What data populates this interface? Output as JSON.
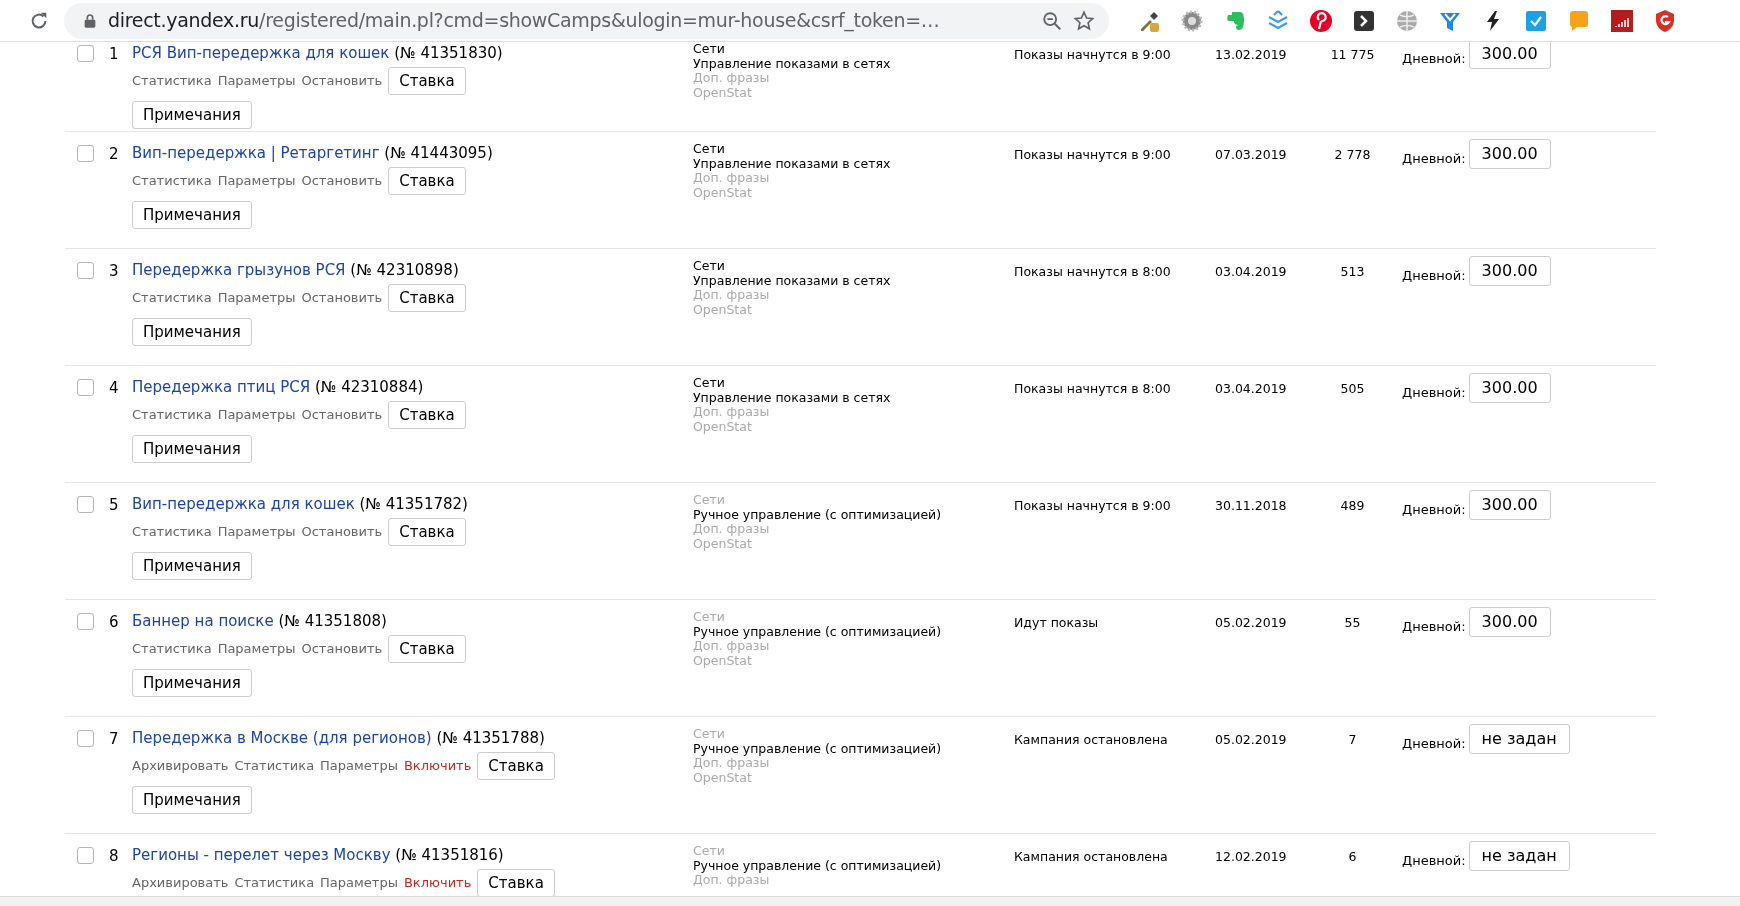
{
  "browser": {
    "url_host": "direct.yandex.ru",
    "url_path": "/registered/main.pl?cmd=showCamps&ulogin=mur-house&csrf_token=…"
  },
  "campaigns": [
    {
      "checked": false,
      "number": "1",
      "title": "РСЯ Вип-передержка для кошек",
      "campaign_id": "(№ 41351830)",
      "actions": [
        {
          "label": "Статистика",
          "kind": "normal"
        },
        {
          "label": "Параметры",
          "kind": "normal"
        },
        {
          "label": "Остановить",
          "kind": "normal"
        }
      ],
      "bid_button": "Ставка",
      "notes_button": "Примечания",
      "strategy": [
        {
          "text": "Сети",
          "muted": false
        },
        {
          "text": "Управление показами в сетях",
          "muted": false
        },
        {
          "text": "Доп. фразы",
          "muted": true
        },
        {
          "text": "OpenStat",
          "muted": true
        }
      ],
      "status": "Показы начнутся в 9:00",
      "date": "13.02.2019",
      "count": "11 775",
      "budget_label": "Дневной:",
      "budget": "300.00"
    },
    {
      "checked": false,
      "number": "2",
      "title": "Вип-передержка | Ретаргетинг",
      "campaign_id": "(№ 41443095)",
      "actions": [
        {
          "label": "Статистика",
          "kind": "normal"
        },
        {
          "label": "Параметры",
          "kind": "normal"
        },
        {
          "label": "Остановить",
          "kind": "normal"
        }
      ],
      "bid_button": "Ставка",
      "notes_button": "Примечания",
      "strategy": [
        {
          "text": "Сети",
          "muted": false
        },
        {
          "text": "Управление показами в сетях",
          "muted": false
        },
        {
          "text": "Доп. фразы",
          "muted": true
        },
        {
          "text": "OpenStat",
          "muted": true
        }
      ],
      "status": "Показы начнутся в 9:00",
      "date": "07.03.2019",
      "count": "2 778",
      "budget_label": "Дневной:",
      "budget": "300.00"
    },
    {
      "checked": false,
      "number": "3",
      "title": "Передержка грызунов РСЯ",
      "campaign_id": "(№ 42310898)",
      "actions": [
        {
          "label": "Статистика",
          "kind": "normal"
        },
        {
          "label": "Параметры",
          "kind": "normal"
        },
        {
          "label": "Остановить",
          "kind": "normal"
        }
      ],
      "bid_button": "Ставка",
      "notes_button": "Примечания",
      "strategy": [
        {
          "text": "Сети",
          "muted": false
        },
        {
          "text": "Управление показами в сетях",
          "muted": false
        },
        {
          "text": "Доп. фразы",
          "muted": true
        },
        {
          "text": "OpenStat",
          "muted": true
        }
      ],
      "status": "Показы начнутся в 8:00",
      "date": "03.04.2019",
      "count": "513",
      "budget_label": "Дневной:",
      "budget": "300.00"
    },
    {
      "checked": false,
      "number": "4",
      "title": "Передержка птиц РСЯ",
      "campaign_id": "(№ 42310884)",
      "actions": [
        {
          "label": "Статистика",
          "kind": "normal"
        },
        {
          "label": "Параметры",
          "kind": "normal"
        },
        {
          "label": "Остановить",
          "kind": "normal"
        }
      ],
      "bid_button": "Ставка",
      "notes_button": "Примечания",
      "strategy": [
        {
          "text": "Сети",
          "muted": false
        },
        {
          "text": "Управление показами в сетях",
          "muted": false
        },
        {
          "text": "Доп. фразы",
          "muted": true
        },
        {
          "text": "OpenStat",
          "muted": true
        }
      ],
      "status": "Показы начнутся в 8:00",
      "date": "03.04.2019",
      "count": "505",
      "budget_label": "Дневной:",
      "budget": "300.00"
    },
    {
      "checked": false,
      "number": "5",
      "title": "Вип-передержка для кошек",
      "campaign_id": "(№ 41351782)",
      "actions": [
        {
          "label": "Статистика",
          "kind": "normal"
        },
        {
          "label": "Параметры",
          "kind": "normal"
        },
        {
          "label": "Остановить",
          "kind": "normal"
        }
      ],
      "bid_button": "Ставка",
      "notes_button": "Примечания",
      "strategy": [
        {
          "text": "Сети",
          "muted": true
        },
        {
          "text": "Ручное управление (с оптимизацией)",
          "muted": false
        },
        {
          "text": "Доп. фразы",
          "muted": true
        },
        {
          "text": "OpenStat",
          "muted": true
        }
      ],
      "status": "Показы начнутся в 9:00",
      "date": "30.11.2018",
      "count": "489",
      "budget_label": "Дневной:",
      "budget": "300.00"
    },
    {
      "checked": false,
      "number": "6",
      "title": "Баннер на поиске",
      "campaign_id": "(№ 41351808)",
      "actions": [
        {
          "label": "Статистика",
          "kind": "normal"
        },
        {
          "label": "Параметры",
          "kind": "normal"
        },
        {
          "label": "Остановить",
          "kind": "normal"
        }
      ],
      "bid_button": "Ставка",
      "notes_button": "Примечания",
      "strategy": [
        {
          "text": "Сети",
          "muted": true
        },
        {
          "text": "Ручное управление (с оптимизацией)",
          "muted": false
        },
        {
          "text": "Доп. фразы",
          "muted": true
        },
        {
          "text": "OpenStat",
          "muted": true
        }
      ],
      "status": "Идут показы",
      "date": "05.02.2019",
      "count": "55",
      "budget_label": "Дневной:",
      "budget": "300.00"
    },
    {
      "checked": false,
      "number": "7",
      "title": "Передержка в Москве (для регионов)",
      "campaign_id": "(№ 41351788)",
      "actions": [
        {
          "label": "Архивировать",
          "kind": "normal"
        },
        {
          "label": "Статистика",
          "kind": "normal"
        },
        {
          "label": "Параметры",
          "kind": "normal"
        },
        {
          "label": "Включить",
          "kind": "danger"
        }
      ],
      "bid_button": "Ставка",
      "notes_button": "Примечания",
      "strategy": [
        {
          "text": "Сети",
          "muted": true
        },
        {
          "text": "Ручное управление (с оптимизацией)",
          "muted": false
        },
        {
          "text": "Доп. фразы",
          "muted": true
        },
        {
          "text": "OpenStat",
          "muted": true
        }
      ],
      "status": "Кампания остановлена",
      "date": "05.02.2019",
      "count": "7",
      "budget_label": "Дневной:",
      "budget": "не задан"
    },
    {
      "checked": false,
      "number": "8",
      "title": "Регионы - перелет через Москву",
      "campaign_id": "(№ 41351816)",
      "actions": [
        {
          "label": "Архивировать",
          "kind": "normal"
        },
        {
          "label": "Статистика",
          "kind": "normal"
        },
        {
          "label": "Параметры",
          "kind": "normal"
        },
        {
          "label": "Включить",
          "kind": "danger"
        }
      ],
      "bid_button": "Ставка",
      "strategy": [
        {
          "text": "Сети",
          "muted": true
        },
        {
          "text": "Ручное управление (с оптимизацией)",
          "muted": false
        },
        {
          "text": "Доп. фразы",
          "muted": true
        }
      ],
      "status": "Кампания остановлена",
      "date": "12.02.2019",
      "count": "6",
      "budget_label": "Дневной:",
      "budget": "не задан"
    }
  ]
}
